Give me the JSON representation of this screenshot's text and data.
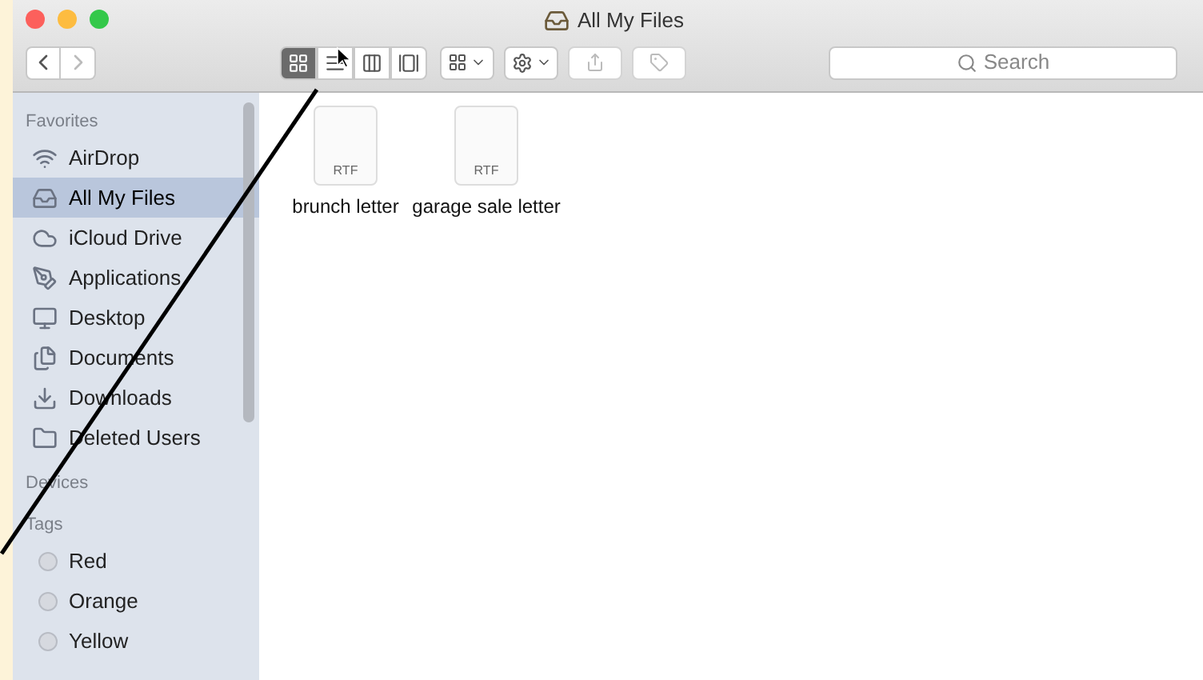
{
  "window": {
    "title": "All My Files"
  },
  "toolbar": {
    "view_modes": [
      {
        "selected": true
      },
      {
        "selected": false
      },
      {
        "selected": false
      },
      {
        "selected": false
      }
    ]
  },
  "search": {
    "placeholder": "Search"
  },
  "sidebar": {
    "sections": [
      {
        "title": "Favorites",
        "kind": "places",
        "items": [
          {
            "label": "AirDrop",
            "selected": false
          },
          {
            "label": "All My Files",
            "selected": true
          },
          {
            "label": "iCloud Drive",
            "selected": false
          },
          {
            "label": "Applications",
            "selected": false
          },
          {
            "label": "Desktop",
            "selected": false
          },
          {
            "label": "Documents",
            "selected": false
          },
          {
            "label": "Downloads",
            "selected": false
          },
          {
            "label": "Deleted Users",
            "selected": false
          }
        ]
      },
      {
        "title": "Devices"
      },
      {
        "title": "Tags",
        "kind": "tags",
        "items": [
          {
            "label": "Red",
            "selected": false
          },
          {
            "label": "Orange",
            "selected": false
          },
          {
            "label": "Yellow",
            "selected": false
          }
        ]
      }
    ]
  },
  "files": [
    {
      "name": "brunch letter",
      "type": "RTF"
    },
    {
      "name": "garage sale letter",
      "type": "RTF"
    }
  ]
}
